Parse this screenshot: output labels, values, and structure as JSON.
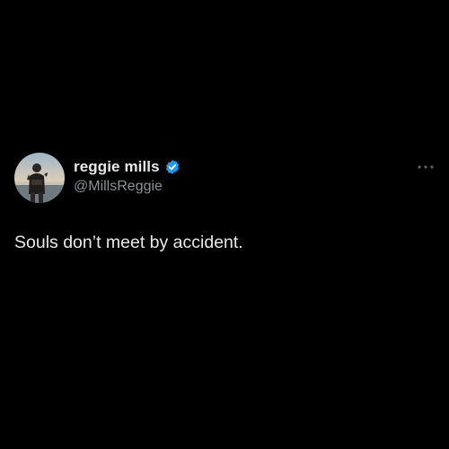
{
  "author": {
    "display_name": "reggie mills",
    "handle": "@MillsReggie",
    "avatar_icon": "profile-photo",
    "verified_icon": "verified-badge-icon",
    "verified_color": "#1d9bf0"
  },
  "tweet": {
    "text": "Souls don’t meet by accident."
  },
  "menu": {
    "icon": "more-options-icon"
  },
  "colors": {
    "background": "#000000",
    "primary_text": "#e7e9ea",
    "secondary_text": "#8b9197"
  }
}
